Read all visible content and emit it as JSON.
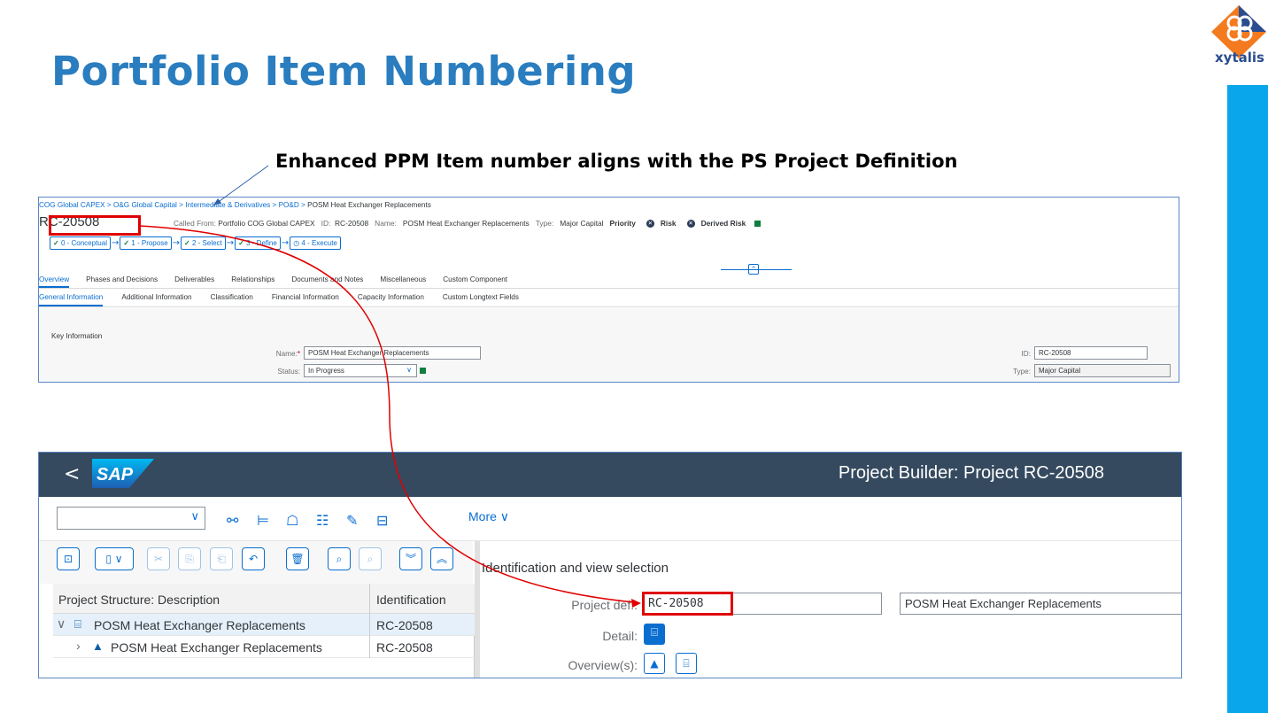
{
  "slide": {
    "title": "Portfolio Item Numbering",
    "annotation": "Enhanced PPM Item number aligns with the PS Project Definition",
    "logo_text": "xytalis"
  },
  "ppm": {
    "breadcrumb": [
      "COG Global CAPEX",
      "O&G Global Capital",
      "Intermediate & Derivatives",
      "PO&D",
      "POSM Heat Exchanger Replacements"
    ],
    "breadcrumb_sep": " > ",
    "item_id": "RC-20508",
    "header": {
      "called_from_label": "Called From:",
      "called_from_value": "Portfolio COG Global CAPEX",
      "id_label": "ID:",
      "id_value": "RC-20508",
      "name_label": "Name:",
      "name_value": "POSM Heat Exchanger Replacements",
      "type_label": "Type:",
      "type_value": "Major Capital",
      "priority_label": "Priority",
      "risk_label": "Risk",
      "derived_risk_label": "Derived Risk"
    },
    "phases": [
      {
        "label": "0 - Conceptual",
        "done": true
      },
      {
        "label": "1 - Propose",
        "done": true
      },
      {
        "label": "2 - Select",
        "done": true
      },
      {
        "label": "3 - Define",
        "done": true
      },
      {
        "label": "4 - Execute",
        "done": false
      }
    ],
    "tabs": [
      "Overview",
      "Phases and Decisions",
      "Deliverables",
      "Relationships",
      "Documents and Notes",
      "Miscellaneous",
      "Custom Component"
    ],
    "subtabs": [
      "General Information",
      "Additional Information",
      "Classification",
      "Financial Information",
      "Capacity Information",
      "Custom Longtext Fields"
    ],
    "section_title": "Key Information",
    "fields": {
      "name_label": "Name:",
      "name_value": "POSM Heat Exchanger Replacements",
      "status_label": "Status:",
      "status_value": "In Progress",
      "id_label": "ID:",
      "id_value": "RC-20508",
      "type_label": "Type:",
      "type_value": "Major Capital"
    }
  },
  "sap": {
    "logo": "SAP",
    "title": "Project Builder: Project RC-20508",
    "toolbar_more": "More",
    "tree": {
      "col_description": "Project Structure: Description",
      "col_identification": "Identification",
      "rows": [
        {
          "description": "POSM Heat Exchanger Replacements",
          "id": "RC-20508"
        },
        {
          "description": "POSM Heat Exchanger Replacements",
          "id": "RC-20508"
        }
      ]
    },
    "detail_panel": {
      "heading": "Identification and view selection",
      "project_def_label": "Project def.:",
      "project_def_value": "RC-20508",
      "project_desc_value": "POSM Heat Exchanger Replacements",
      "detail_label": "Detail:",
      "overview_label": "Overview(s):"
    }
  },
  "colors": {
    "title": "#2a7dbf",
    "accent_band": "#0aa6ec",
    "highlight": "#e00000",
    "sap_shell": "#354a5f",
    "fiori_blue": "#0a6ed1"
  }
}
